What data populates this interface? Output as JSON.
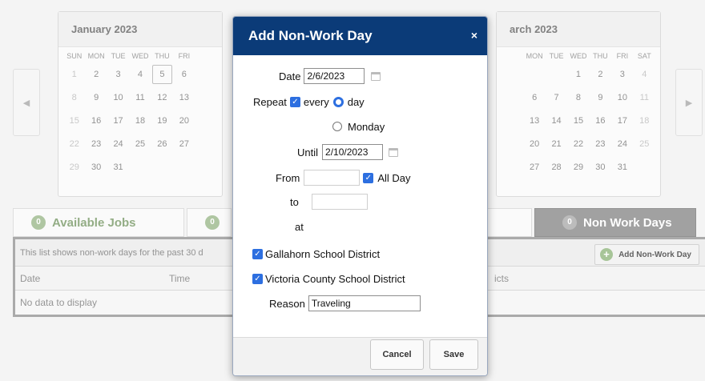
{
  "calendar_left": {
    "month": "January 2023",
    "dow": [
      "SUN",
      "MON",
      "TUE",
      "WED",
      "THU",
      "FRI"
    ],
    "weeks": [
      [
        "1",
        "2",
        "3",
        "4",
        "5",
        "6"
      ],
      [
        "8",
        "9",
        "10",
        "11",
        "12",
        "13"
      ],
      [
        "15",
        "16",
        "17",
        "18",
        "19",
        "20"
      ],
      [
        "22",
        "23",
        "24",
        "25",
        "26",
        "27"
      ],
      [
        "29",
        "30",
        "31",
        "",
        "",
        ""
      ]
    ]
  },
  "calendar_right": {
    "month": "arch 2023",
    "dow": [
      "MON",
      "TUE",
      "WED",
      "THU",
      "FRI",
      "SAT"
    ],
    "weeks": [
      [
        "",
        "",
        "1",
        "2",
        "3",
        "4"
      ],
      [
        "6",
        "7",
        "8",
        "9",
        "10",
        "11"
      ],
      [
        "13",
        "14",
        "15",
        "16",
        "17",
        "18"
      ],
      [
        "20",
        "21",
        "22",
        "23",
        "24",
        "25"
      ],
      [
        "27",
        "28",
        "29",
        "30",
        "31",
        ""
      ]
    ]
  },
  "tabs": {
    "available": {
      "count": "0",
      "label": "Available Jobs"
    },
    "middle": {
      "count": "0"
    },
    "non_work": {
      "count": "0",
      "label": "Non Work Days"
    }
  },
  "panel": {
    "info": "This list shows non-work days for the past 30 d",
    "add_button": "Add Non-Work Day",
    "columns": {
      "date": "Date",
      "time": "Time",
      "districts": "icts"
    },
    "empty": "No data to display"
  },
  "modal": {
    "title": "Add Non-Work Day",
    "close": "×",
    "date_label": "Date",
    "date_value": "2/6/2023",
    "repeat_label": "Repeat",
    "every_label": "every",
    "day_label": "day",
    "monday_label": "Monday",
    "until_label": "Until",
    "until_value": "2/10/2023",
    "from_label": "From",
    "all_day_label": "All Day",
    "to_label": "to",
    "at_label": "at",
    "district_1": "Gallahorn School District",
    "district_2": "Victoria County School District",
    "reason_label": "Reason",
    "reason_value": "Traveling",
    "cancel": "Cancel",
    "save": "Save"
  },
  "icons": {
    "checkbox_checked": "✓",
    "arrow_left": "◀",
    "arrow_right": "▶",
    "plus": "+"
  }
}
